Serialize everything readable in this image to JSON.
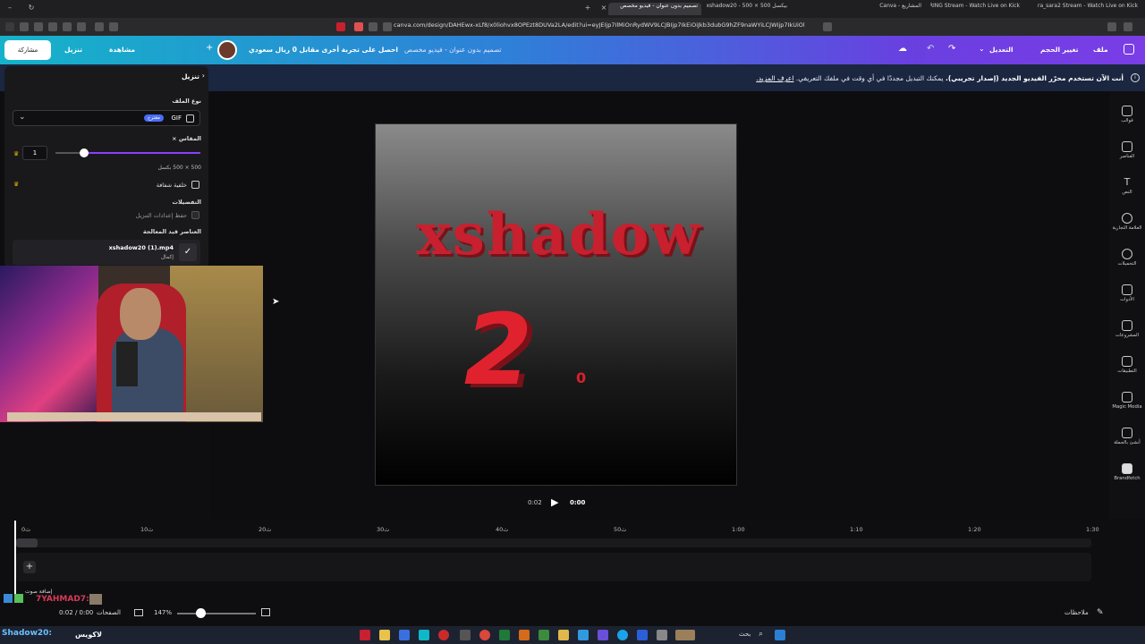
{
  "browser": {
    "tabs": [
      {
        "label": "Ultra_sara2 Stream - Watch Live on Kick",
        "active": false
      },
      {
        "label": "3MARING Stream - Watch Live on Kick",
        "active": false
      },
      {
        "label": "المشاريع - Canva",
        "active": false
      },
      {
        "label": "بيكسل 500 × 500 - xshadow20",
        "active": false
      },
      {
        "label": "تصميم بدون عنوان - فيديو مخصص",
        "active": true
      }
    ],
    "url": "canva.com/design/DAHEwx-xLf8/x0liohvx8OPEzt8DUVa2LA/edit?ui=eyJEIjp7IlMiOnRydWV9LCJBIjp7IkEiOiJkb3dubG9hZF9naWYiLCJWIjp7IkUiOlsiR0lGIl19fX0"
  },
  "header": {
    "home_menu": "ملف",
    "resize": "تغيير الحجم",
    "edit_mode": "التعديل",
    "doc_title": "تصميم بدون عنوان - فيديو مخصص",
    "promo": "احصل على تجربة أخرى مقابل 0 ريال سعودي",
    "download": "تنزيل",
    "share": "مشاركة",
    "present": "مشاهدة"
  },
  "banner": {
    "text_bold": "أنت الآن تستخدم محرّر الفيديو الجديد (إصدار تجريبي).",
    "text_rest": " يمكنك التبديل مجددًا في أي وقت في ملفك التعريفي. ",
    "link": "اعرف المزيد."
  },
  "download_panel": {
    "title": "تنزيل",
    "file_type_label": "نوع الملف",
    "file_type_value": "GIF",
    "file_type_badge": "مقترح",
    "size_label": "المقاس ×",
    "size_value": "1",
    "size_level": 0.2,
    "size_px": "500 × 500 بكسل",
    "transparent_bg": "خلفية شفافة",
    "preferences_label": "التفضيلات",
    "save_settings": "حفظ إعدادات التنزيل",
    "in_progress_label": "العناصر قيد المعالجة",
    "file_name": "xshadow20 (1).mp4",
    "file_status": "إكمال"
  },
  "rail": {
    "items": [
      {
        "label": "قوالب",
        "icon": "templates-icon"
      },
      {
        "label": "العناصر",
        "icon": "elements-icon"
      },
      {
        "label": "النص",
        "icon": "text-icon"
      },
      {
        "label": "العلامة التجارية",
        "icon": "brand-icon"
      },
      {
        "label": "التحميلات",
        "icon": "uploads-icon"
      },
      {
        "label": "الأدوات",
        "icon": "tools-icon"
      },
      {
        "label": "المشروعات",
        "icon": "projects-icon"
      },
      {
        "label": "التطبيقات",
        "icon": "apps-icon"
      },
      {
        "label": "Magic Media",
        "icon": "magic-media-icon"
      },
      {
        "label": "أنشئ بالجملة",
        "icon": "bulk-create-icon"
      },
      {
        "label": "Brandfetch",
        "icon": "brandfetch-icon"
      }
    ]
  },
  "canvas": {
    "headline": "xshadow",
    "big_number": "2",
    "small_number": "0"
  },
  "playback": {
    "current": "0:00",
    "total": "0:02"
  },
  "timeline": {
    "ticks": [
      "0ث",
      "10ث",
      "20ث",
      "30ث",
      "40ث",
      "50ث",
      "1:00",
      "1:10",
      "1:20",
      "1:30"
    ],
    "add_audio": "إضافة صوت"
  },
  "footer": {
    "notes": "ملاحظات",
    "pages": "الصفحات",
    "time": "0:02 / 0:00",
    "zoom": "147%",
    "zoom_level": 0.3
  },
  "overlay": {
    "chat_1": "7YAHMAD7:",
    "chat_2": "Shadow20:",
    "chat_3": "لاكويس"
  },
  "taskbar": {
    "search": "بحث"
  },
  "colors": {
    "header_start": "#15b3c9",
    "header_end": "#7a3de6",
    "accent_purple": "#8b3dff",
    "title_red": "#c8202e"
  }
}
